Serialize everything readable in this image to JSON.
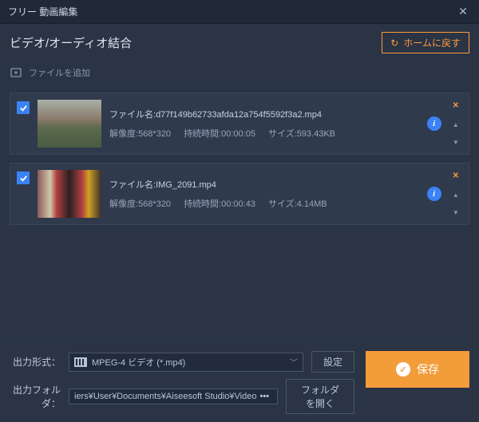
{
  "titleBar": {
    "title": "フリー 動画編集"
  },
  "header": {
    "title": "ビデオ/オーディオ結合",
    "homeBtn": "ホームに戻す"
  },
  "toolbar": {
    "addFile": "ファイルを追加"
  },
  "files": [
    {
      "filenameLabel": "ファイル名:",
      "filename": "d77f149b62733afda12a754f5592f3a2.mp4",
      "resLabel": "解像度:",
      "resolution": "568*320",
      "durLabel": "持続時間:",
      "duration": "00:00:05",
      "sizeLabel": "サイズ:",
      "size": "593.43KB"
    },
    {
      "filenameLabel": "ファイル名:",
      "filename": "IMG_2091.mp4",
      "resLabel": "解像度:",
      "resolution": "568*320",
      "durLabel": "持続時間:",
      "duration": "00:00:43",
      "sizeLabel": "サイズ:",
      "size": "4.14MB"
    }
  ],
  "footer": {
    "formatLabel": "出力形式：",
    "formatValue": "MPEG-4 ビデオ (*.mp4)",
    "settingsBtn": "設定",
    "folderLabel": "出力フォルダ：",
    "folderValue": "iers¥User¥Documents¥Aiseesoft Studio¥Video",
    "openFolderBtn": "フォルダを開く",
    "saveBtn": "保存"
  }
}
